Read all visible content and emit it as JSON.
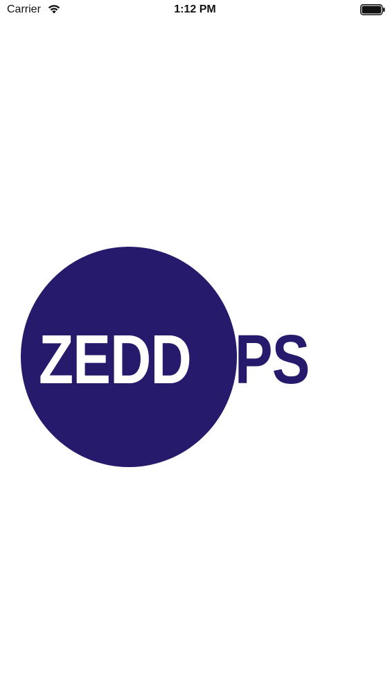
{
  "status_bar": {
    "carrier": "Carrier",
    "time": "1:12 PM",
    "wifi_icon": "wifi-icon",
    "battery_icon": "battery-icon",
    "battery_level": 1.0
  },
  "splash": {
    "logo": {
      "word_first": "ZEDD",
      "word_second": "GPS",
      "brand_color": "#251A6B",
      "inverse_color": "#FFFFFF"
    }
  }
}
